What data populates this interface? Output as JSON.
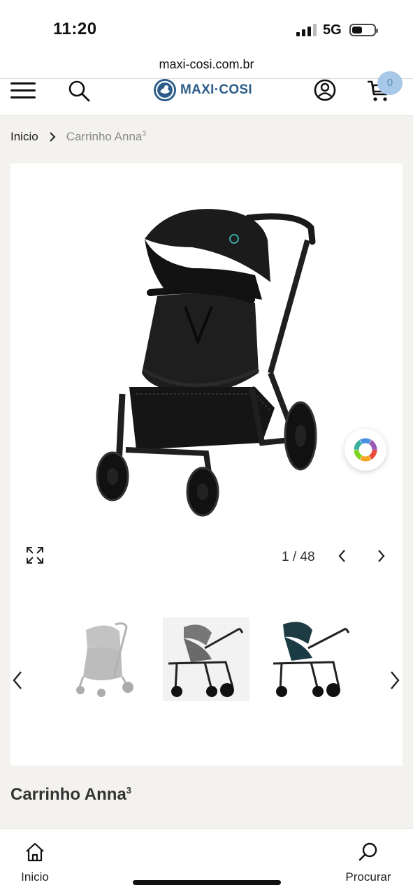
{
  "status_bar": {
    "time": "11:20",
    "network": "5G"
  },
  "browser": {
    "url": "maxi-cosi.com.br"
  },
  "header": {
    "logo_text": "MAXI·COSI",
    "cart_count": "0",
    "menu_icon": "hamburger-icon",
    "search_icon": "search-icon",
    "account_icon": "account-icon",
    "cart_icon": "cart-icon"
  },
  "breadcrumb": {
    "home": "Inicio",
    "current": "Carrinho Anna",
    "current_superscript": "3"
  },
  "gallery": {
    "counter": "1 / 48",
    "main_image": "black-stroller-image",
    "thumbnails": [
      {
        "image": "grey-stroller-thumbnail"
      },
      {
        "image": "grey-stroller-side-thumbnail"
      },
      {
        "image": "teal-stroller-side-thumbnail"
      }
    ]
  },
  "product": {
    "title": "Carrinho Anna",
    "title_superscript": "3"
  },
  "bottom_nav": {
    "home_label": "Inicio",
    "search_label": "Procurar"
  },
  "colors": {
    "brand": "#2d5d8a",
    "page_background": "#f3f2ef",
    "cart_badge": "#a8c8e8"
  }
}
